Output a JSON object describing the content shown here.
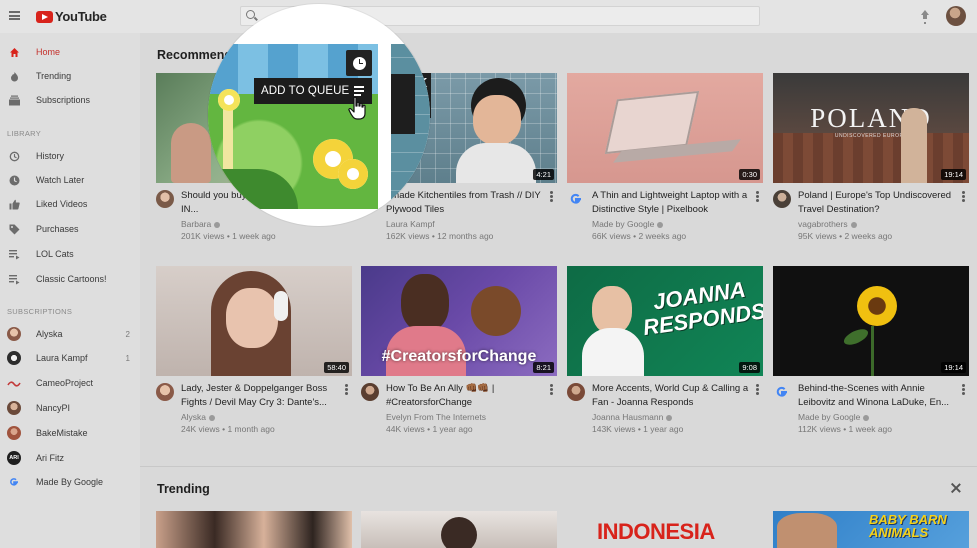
{
  "app": {
    "logo_text": "YouTube"
  },
  "sidebar": {
    "main": [
      {
        "label": "Home",
        "icon": "home-icon",
        "active": true
      },
      {
        "label": "Trending",
        "icon": "flame-icon"
      },
      {
        "label": "Subscriptions",
        "icon": "subscriptions-icon"
      }
    ],
    "library_title": "LIBRARY",
    "library": [
      {
        "label": "History",
        "icon": "history-icon"
      },
      {
        "label": "Watch Later",
        "icon": "clock-icon"
      },
      {
        "label": "Liked Videos",
        "icon": "thumbs-up-icon"
      },
      {
        "label": "Purchases",
        "icon": "tag-icon"
      },
      {
        "label": "LOL Cats",
        "icon": "playlist-icon"
      },
      {
        "label": "Classic Cartoons!",
        "icon": "playlist-icon"
      }
    ],
    "subscriptions_title": "SUBSCRIPTIONS",
    "subscriptions": [
      {
        "label": "Alyska",
        "count": "2"
      },
      {
        "label": "Laura Kampf",
        "count": "1"
      },
      {
        "label": "CameoProject",
        "count": ""
      },
      {
        "label": "NancyPI",
        "count": ""
      },
      {
        "label": "BakeMistake",
        "count": ""
      },
      {
        "label": "Ari Fitz",
        "count": ""
      },
      {
        "label": "Made By Google",
        "count": ""
      }
    ]
  },
  "sections": {
    "recommended_title": "Recommended",
    "trending_title": "Trending"
  },
  "videos": [
    {
      "title": "Should you buy ... World?? | EARLY IN...",
      "channel": "Barbara",
      "meta": "201K views • 1 week ago",
      "duration": ""
    },
    {
      "title": "I made Kitchentiles from Trash // DIY Plywood Tiles",
      "channel": "Laura Kampf",
      "meta": "162K views • 12 months ago",
      "duration": "4:21"
    },
    {
      "title": "A Thin and Lightweight Laptop with a Distinctive Style | Pixelbook",
      "channel": "Made by Google",
      "meta": "66K views • 2 weeks ago",
      "duration": "0:30"
    },
    {
      "title": "Poland | Europe's Top Undiscovered Travel Destination?",
      "channel": "vagabrothers",
      "meta": "95K views • 2 weeks ago",
      "duration": "19:14"
    },
    {
      "title": "Lady, Jester & Doppelganger Boss Fights / Devil May Cry 3: Dante's...",
      "channel": "Alyska",
      "meta": "24K views • 1 month ago",
      "duration": "58:40"
    },
    {
      "title": "How To Be An Ally 👊🏾👊🏾 | #CreatorsforChange",
      "channel": "Evelyn From The Internets",
      "meta": "44K views • 1 year ago",
      "duration": "8:21"
    },
    {
      "title": "More Accents, World Cup & Calling a Fan - Joanna Responds",
      "channel": "Joanna Hausmann",
      "meta": "143K views • 1 year ago",
      "duration": "9:08"
    },
    {
      "title": "Behind-the-Scenes with Annie Leibovitz and Winona LaDuke, En...",
      "channel": "Made by Google",
      "meta": "112K views • 1 week ago",
      "duration": "19:14"
    }
  ],
  "thumb_text": {
    "poland_big": "POLAND",
    "poland_small": "UNDISCOVERED EUROPE",
    "creators": "#CreatorsforChange",
    "joanna": "JOANNA RESPONDS!",
    "kitchen": "L K",
    "indonesia": "INDONESIA",
    "baby_barn": "BABY BARN ANIMALS"
  },
  "magnifier": {
    "tooltip": "ADD TO QUEUE",
    "title_fragment": "d"
  }
}
